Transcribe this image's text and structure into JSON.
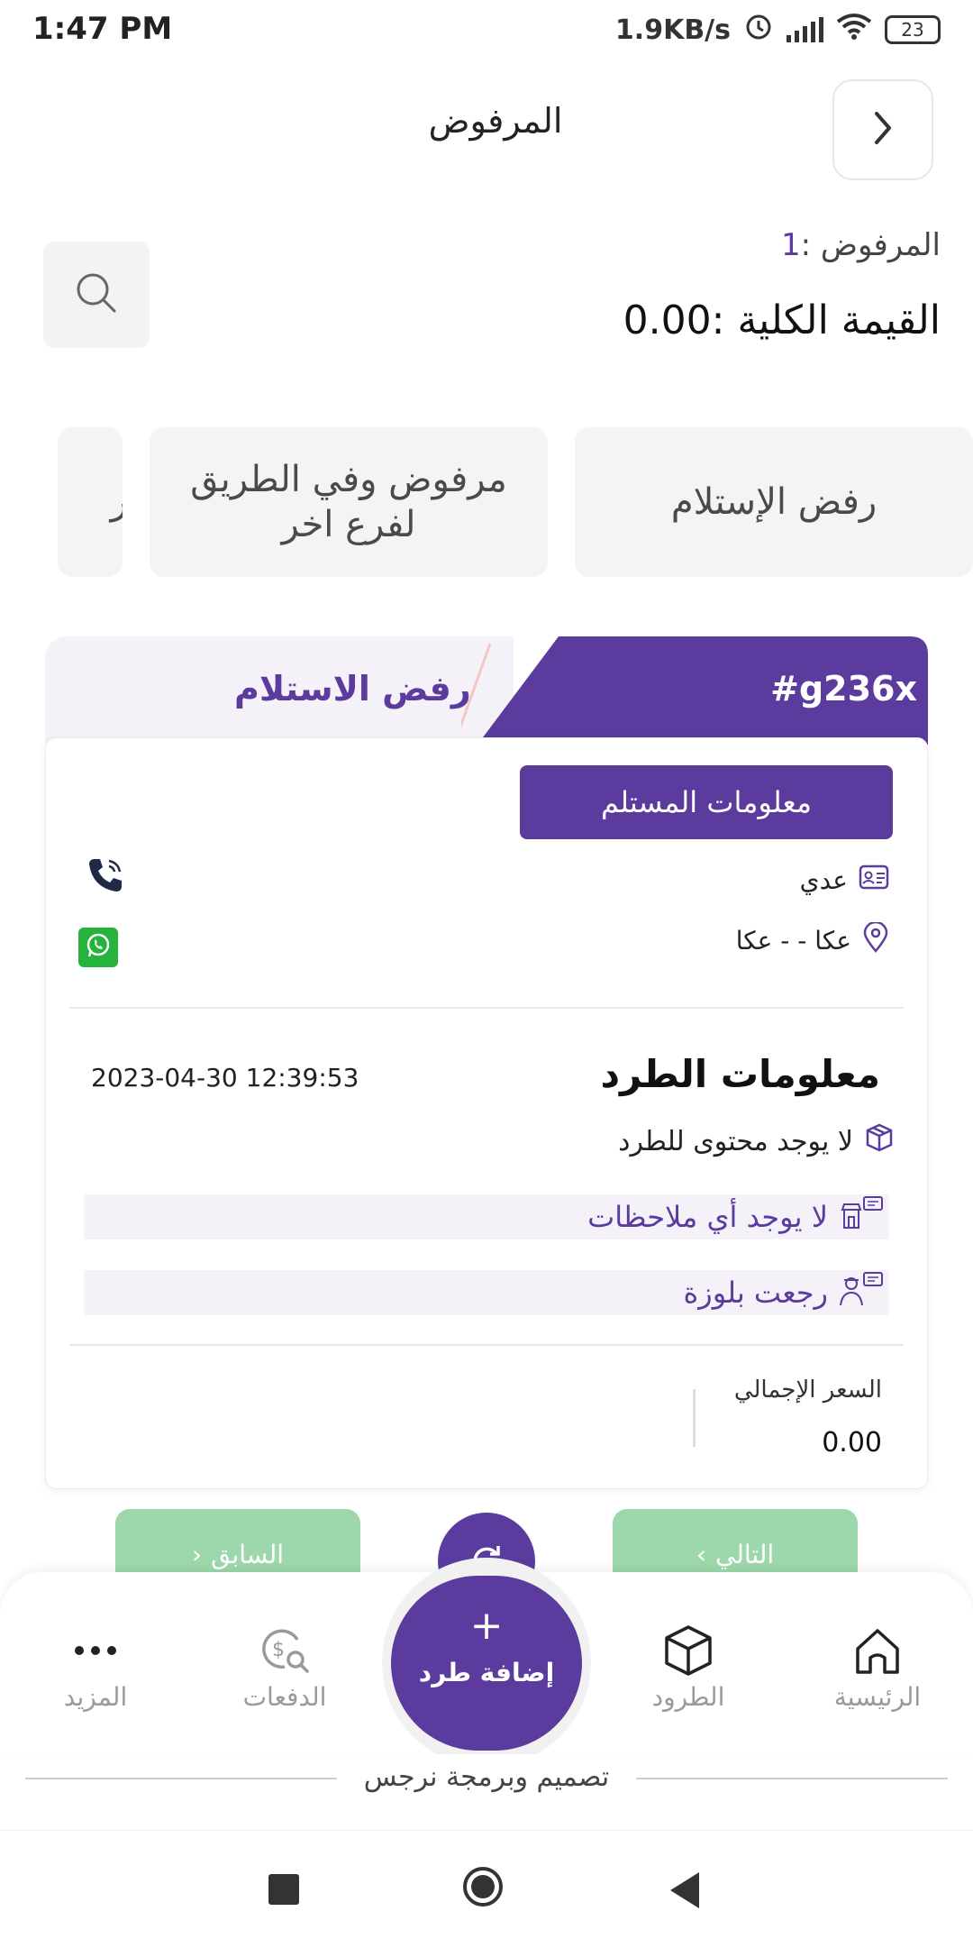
{
  "status_bar": {
    "time": "1:47 PM",
    "speed": "1.9KB/s",
    "battery": "23"
  },
  "header": {
    "title": "المرفوض",
    "back_icon": "chevron-right-icon"
  },
  "summary": {
    "count_label": "المرفوض :",
    "count_value": "1",
    "total": "القيمة الكلية :0.00"
  },
  "filters": [
    {
      "label": "رفض الإستلام"
    },
    {
      "label": "مرفوض وفي الطريق لفرع اخر"
    },
    {
      "label": "مر"
    }
  ],
  "shipment": {
    "id": "#g236x",
    "status": "رفض الاستلام",
    "receiver_button": "معلومات المستلم",
    "receiver_name": "عدي",
    "receiver_address": "عكا - - عكا",
    "parcel_title": "معلومات الطرد",
    "date": "2023-04-30 12:39:53",
    "content": "لا يوجد محتوى للطرد",
    "store_note": "لا يوجد أي ملاحظات",
    "driver_note": "رجعت بلوزة",
    "price_label": "السعر الإجمالي",
    "price_value": "0.00"
  },
  "pager": {
    "prev": "السابق",
    "next": "التالي"
  },
  "bottom_nav": {
    "home": "الرئيسية",
    "parcels": "الطرود",
    "add": "إضافة طرد",
    "payments": "الدفعات",
    "more": "المزيد"
  },
  "credit": "تصميم وبرمجة نرجس",
  "colors": {
    "primary": "#5b3b9e",
    "accent_green": "#9dd8ac",
    "whatsapp": "#25b33c"
  }
}
